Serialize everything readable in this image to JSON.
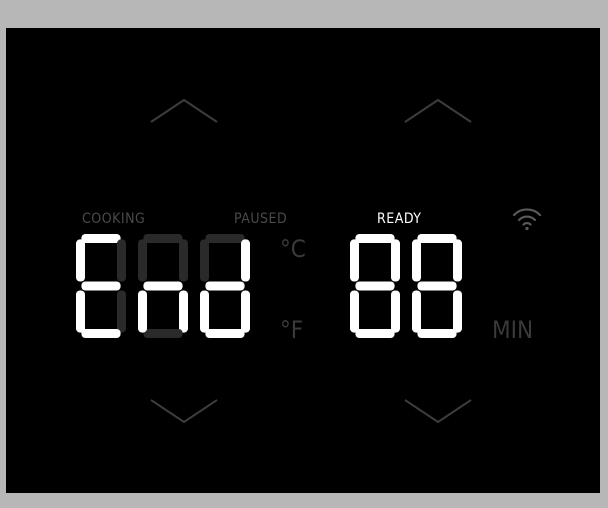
{
  "display": {
    "status_labels": {
      "cooking": "COOKING",
      "paused": "PAUSED",
      "ready": "READY"
    },
    "temperature_units": {
      "celsius": "°C",
      "fahrenheit": "°F"
    },
    "time_unit": "MIN",
    "main_readout": [
      "E",
      "n",
      "d"
    ],
    "timer_readout": [
      "8",
      "8"
    ],
    "active_status": "ready",
    "icons": [
      "chevron-up-icon",
      "chevron-down-icon",
      "wifi-icon"
    ]
  },
  "colors": {
    "panel_background": "#000000",
    "frame": "#b7b7b7",
    "segment_on": "#ffffff",
    "segment_off": "#2a2a2a",
    "label_dim": "#4a4a4a",
    "label_active": "#ffffff"
  }
}
